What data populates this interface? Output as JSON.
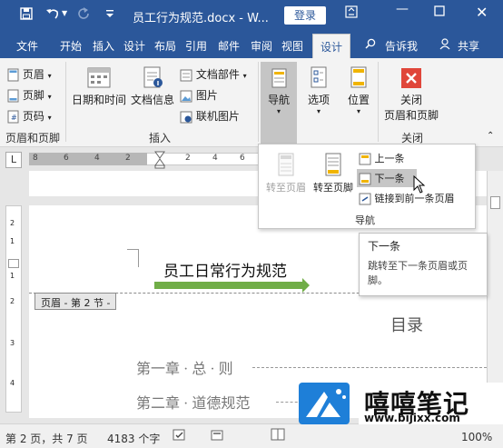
{
  "titlebar": {
    "doc_title": "员工行为规范.docx - W...",
    "login": "登录",
    "bg_color": "#2b579a"
  },
  "tabs": [
    "文件",
    "开始",
    "插入",
    "设计",
    "布局",
    "引用",
    "邮件",
    "审阅",
    "视图",
    "设计"
  ],
  "tell_me": "告诉我",
  "share": "共享",
  "ribbon": {
    "header_footer": {
      "header": "页眉",
      "footer": "页脚",
      "page_number": "页码",
      "group": "页眉和页脚"
    },
    "insert": {
      "datetime": "日期和时间",
      "docinfo": "文档信息",
      "parts": "文档部件",
      "picture": "图片",
      "online_picture": "联机图片",
      "group": "插入"
    },
    "navigation": {
      "label": "导航"
    },
    "options": {
      "label": "选项"
    },
    "position": {
      "label": "位置"
    },
    "close": {
      "label_line1": "关闭",
      "label_line2": "页眉和页脚",
      "group": "关闭"
    }
  },
  "ruler_ticks": [
    "8",
    "6",
    "4",
    "2",
    "2",
    "4",
    "6"
  ],
  "tab_selector": "L",
  "vruler_ticks": [
    "2",
    "1",
    "1",
    "2",
    "3",
    "4"
  ],
  "nav_dropdown": {
    "goto_header": "转至页眉",
    "goto_footer": "转至页脚",
    "previous": "上一条",
    "next": "下一条",
    "link_previous": "链接到前一条页眉",
    "group": "导航"
  },
  "tooltip": {
    "title": "下一条",
    "desc": "跳转至下一条页眉或页脚。"
  },
  "document": {
    "header_text": "员工日常行为规范",
    "section_tag": "页眉 - 第 2 节 -",
    "toc_title": "目录",
    "toc_items": [
      {
        "text": "第一章 · 总 · 则"
      },
      {
        "text": "第二章 · 道德规范"
      }
    ]
  },
  "statusbar": {
    "page": "第 2 页，共 7 页",
    "words": "4183 个字",
    "zoom": "100%"
  },
  "watermark": {
    "brand": "嘻嘻笔记",
    "url": "www.bijixx.com"
  },
  "colors": {
    "accent": "#2b579a",
    "green_bar": "#70ad47",
    "close_red": "#e0463a",
    "logo_blue": "#1e7fd8"
  }
}
